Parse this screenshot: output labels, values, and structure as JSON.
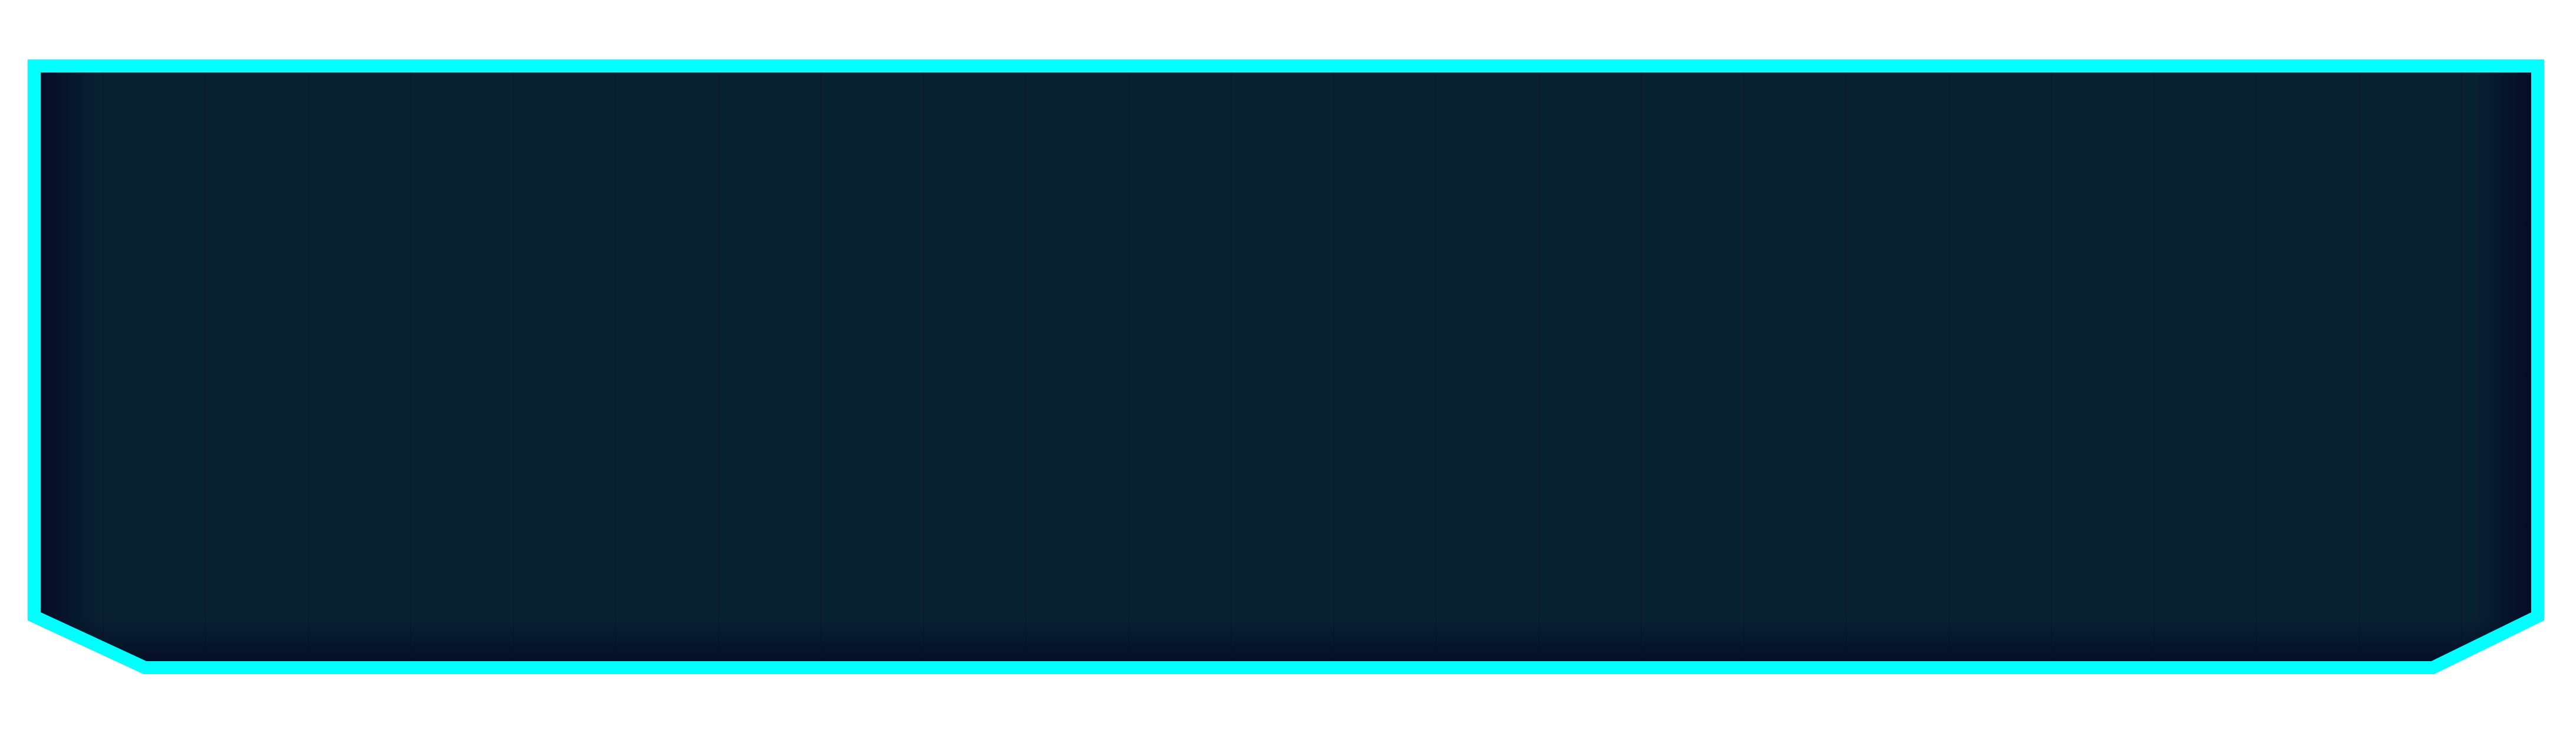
{
  "panel": {
    "border_color": "#00FFFF",
    "fill_color": "#082131",
    "edge_shadow_color": "#040A24",
    "grid_line_color": "#07162A"
  }
}
